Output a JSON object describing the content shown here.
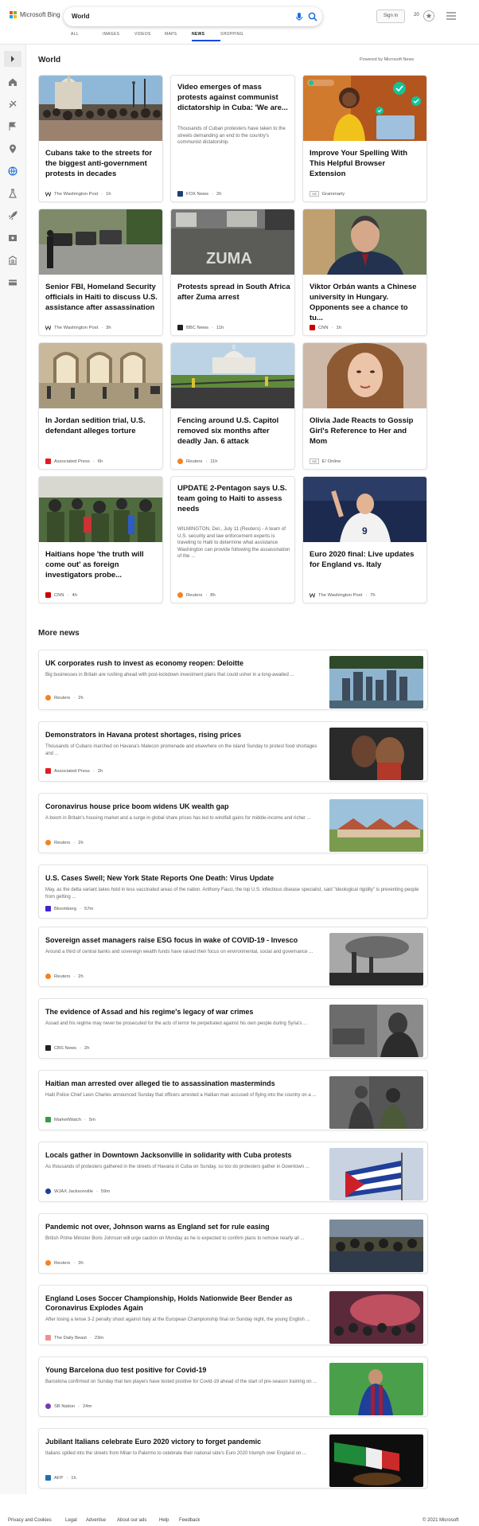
{
  "header": {
    "brand": "Microsoft Bing",
    "search_query": "World",
    "sign_in": "Sign in",
    "reward_points": "20",
    "tabs": [
      "ALL",
      "IMAGES",
      "VIDEOS",
      "MAPS",
      "NEWS",
      "SHOPPING"
    ],
    "active_tab": "NEWS"
  },
  "rail": {
    "icons": [
      "expand-icon",
      "home-icon",
      "sports-icon",
      "flag-icon",
      "location-icon",
      "globe-icon",
      "science-icon",
      "rocket-icon",
      "entertainment-icon",
      "money-icon",
      "card-icon"
    ]
  },
  "world": {
    "title": "World",
    "powered_by": "Powered by Microsoft News",
    "cards": [
      {
        "title": "Cubans take to the streets for the biggest anti-government protests in decades",
        "source": "The Washington Post",
        "time": "1h"
      },
      {
        "title": "Video emerges of mass protests against communist dictatorship in Cuba: 'We are...",
        "snippet": "Thousands of Cuban protesters have taken to the streets demanding an end to the country's communist dictatorship.",
        "source": "FOX News",
        "time": "2h"
      },
      {
        "title": "Improve Your Spelling With This Helpful Browser Extension",
        "ad": "Ad",
        "source": "Grammarly"
      },
      {
        "title": "Senior FBI, Homeland Security officials in Haiti to discuss U.S. assistance after assassination",
        "source": "The Washington Post",
        "time": "3h"
      },
      {
        "title": "Protests spread in South Africa after Zuma arrest",
        "source": "BBC News",
        "time": "11h"
      },
      {
        "title": "Viktor Orbán wants a Chinese university in Hungary. Opponents see a chance to tu...",
        "source": "CNN",
        "time": "1h"
      },
      {
        "title": "In Jordan sedition trial, U.S. defendant alleges torture",
        "source": "Associated Press",
        "time": "6h"
      },
      {
        "title": "Fencing around U.S. Capitol removed six months after deadly Jan. 6 attack",
        "source": "Reuters",
        "time": "11h"
      },
      {
        "title": "Olivia Jade Reacts to Gossip Girl's Reference to Her and Mom",
        "ad": "Ad",
        "source": "E! Online"
      },
      {
        "title": "Haitians hope 'the truth will come out' as foreign investigators probe...",
        "source": "CNN",
        "time": "4h"
      },
      {
        "title": "UPDATE 2-Pentagon says U.S. team going to Haiti to assess needs",
        "snippet": "WILMINGTON, Del., July 11 (Reuters) - A team of U.S. security and law enforcement experts is traveling to Haiti to determine what assistance Washington can provide following the assassination of the ...",
        "source": "Reuters",
        "time": "8h"
      },
      {
        "title": "Euro 2020 final: Live updates for England vs. Italy",
        "source": "The Washington Post",
        "time": "7h"
      }
    ]
  },
  "more_news": {
    "title": "More news",
    "items": [
      {
        "title": "UK corporates rush to invest as economy reopen: Deloitte",
        "snippet": "Big businesses in Britain are rushing ahead with post-lockdown investment plans that could usher in a long-awaited ...",
        "source": "Reuters",
        "time": "2h"
      },
      {
        "title": "Demonstrators in Havana protest shortages, rising prices",
        "snippet": "Thousands of Cubans marched on Havana's Malecon promenade and elsewhere on the island Sunday to protest food shortages and ...",
        "source": "Associated Press",
        "time": "2h"
      },
      {
        "title": "Coronavirus house price boom widens UK wealth gap",
        "snippet": "A boom in Britain's housing market and a surge in global share prices has led to windfall gains for middle-income and richer ...",
        "source": "Reuters",
        "time": "2h"
      },
      {
        "title": "U.S. Cases Swell; New York State Reports One Death: Virus Update",
        "snippet": "May, as the delta variant takes hold in less vaccinated areas of the nation. Anthony Fauci, the top U.S. infectious disease specialist, said \"ideological rigidity\" is preventing people from getting ...",
        "source": "Bloomberg",
        "time": "57m"
      },
      {
        "title": "Sovereign asset managers raise ESG focus in wake of COVID-19 - Invesco",
        "snippet": "Around a third of central banks and sovereign wealth funds have raised their focus on environmental, social and governance ...",
        "source": "Reuters",
        "time": "2h"
      },
      {
        "title": "The evidence of Assad and his regime's legacy of war crimes",
        "snippet": "Assad and his regime may never be prosecuted for the acts of terror he perpetrated against his own people during Syria's ...",
        "source": "CBS News",
        "time": "2h"
      },
      {
        "title": "Haitian man arrested over alleged tie to assassination masterminds",
        "snippet": "Haiti Police Chief Leon Charles announced Sunday that officers arrested a Haitian man accused of flying into the country on a ...",
        "source": "MarketWatch",
        "time": "5m"
      },
      {
        "title": "Locals gather in Downtown Jacksonville in solidarity with Cuba protests",
        "snippet": "As thousands of protesters gathered in the streets of Havana in Cuba on Sunday, so too do protesters gather in Downtown ...",
        "source": "WJAX Jacksonville",
        "time": "59m"
      },
      {
        "title": "Pandemic not over, Johnson warns as England set for rule easing",
        "snippet": "British Prime Minister Boris Johnson will urge caution on Monday as he is expected to confirm plans to remove nearly all ...",
        "source": "Reuters",
        "time": "3h"
      },
      {
        "title": "England Loses Soccer Championship, Holds Nationwide Beer Bender as Coronavirus Explodes Again",
        "snippet": "After losing a tense 3-2 penalty shoot against Italy at the European Championship final on Sunday night, the young English ...",
        "source": "The Daily Beast",
        "time": "23m"
      },
      {
        "title": "Young Barcelona duo test positive for Covid-19",
        "snippet": "Barcelona confirmed on Sunday that two players have tested positive for Covid-19 ahead of the start of pre-season training on ...",
        "source": "SB Nation",
        "time": "24m"
      },
      {
        "title": "Jubilant Italians celebrate Euro 2020 victory to forget pandemic",
        "snippet": "Italians spilled into the streets from Milan to Palermo to celebrate their national side's Euro 2020 triumph over England on ...",
        "source": "AFP",
        "time": "1h"
      }
    ]
  },
  "footer": {
    "links": [
      "Privacy and Cookies",
      "Legal",
      "Advertise",
      "About our ads",
      "Help",
      "Feedback"
    ],
    "copyright": "© 2021 Microsoft"
  },
  "colors": {
    "accent": "#174ae4",
    "reuters": "#f58220",
    "cnn": "#cc0000",
    "ap": "#e31b23"
  }
}
